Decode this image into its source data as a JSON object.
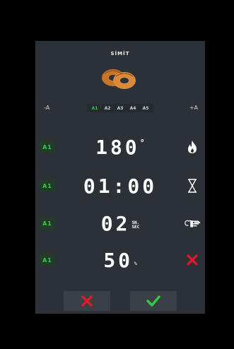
{
  "header": {
    "title": "SİMİT",
    "product_icon": "simit-bread-icon"
  },
  "adjust": {
    "minus_label": "-A",
    "plus_label": "+A"
  },
  "presets": [
    {
      "label": "A1",
      "active": true
    },
    {
      "label": "A2",
      "active": false
    },
    {
      "label": "A3",
      "active": false
    },
    {
      "label": "A4",
      "active": false
    },
    {
      "label": "A5",
      "active": false
    }
  ],
  "settings": {
    "temperature": {
      "tag": "A1",
      "value": "180",
      "unit": "°",
      "icon": "flame-icon"
    },
    "time": {
      "tag": "A1",
      "value": "01:00",
      "icon": "hourglass-icon"
    },
    "steam": {
      "tag": "A1",
      "value": "02",
      "unit_top": "SN.",
      "unit_bottom": "SEC",
      "icon": "steam-hand-icon"
    },
    "fan": {
      "tag": "A1",
      "value": "50",
      "unit": "%",
      "icon": "close-x-icon"
    }
  },
  "actions": {
    "cancel_icon": "close-x-icon",
    "confirm_icon": "checkmark-icon"
  },
  "colors": {
    "accent_green": "#2ecc40",
    "alert_red": "#e8172a",
    "panel_bg": "#2b3136"
  }
}
